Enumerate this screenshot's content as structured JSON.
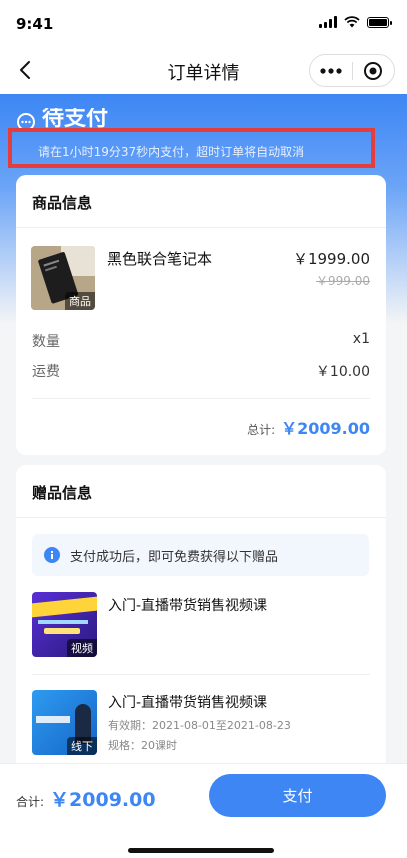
{
  "status_bar": {
    "time": "9:41"
  },
  "nav": {
    "title": "订单详情"
  },
  "order_status": {
    "title": "待支付",
    "countdown": "请在1小时19分37秒内支付，超时订单将自动取消"
  },
  "product": {
    "section_title": "商品信息",
    "name": "黑色联合笔记本",
    "price": "￥1999.00",
    "original_price": "￥999.00",
    "thumb_tag": "商品",
    "quantity_label": "数量",
    "quantity_value": "x1",
    "shipping_label": "运费",
    "shipping_value": "￥10.00",
    "total_label": "总计:",
    "total_value": "￥2009.00"
  },
  "gifts": {
    "section_title": "赠品信息",
    "notice": "支付成功后，即可免费获得以下赠品",
    "items": [
      {
        "title": "入门-直播带货销售视频课",
        "tag": "视频"
      },
      {
        "title": "入门-直播带货销售视频课",
        "tag": "线下",
        "validity": "有效期：2021-08-01至2021-08-23",
        "spec": "规格：20课时"
      }
    ]
  },
  "footer": {
    "total_label": "合计:",
    "total_value": "￥2009.00",
    "pay_button": "支付"
  },
  "colors": {
    "accent": "#3d86f4",
    "highlight_border": "#e33e3c"
  }
}
